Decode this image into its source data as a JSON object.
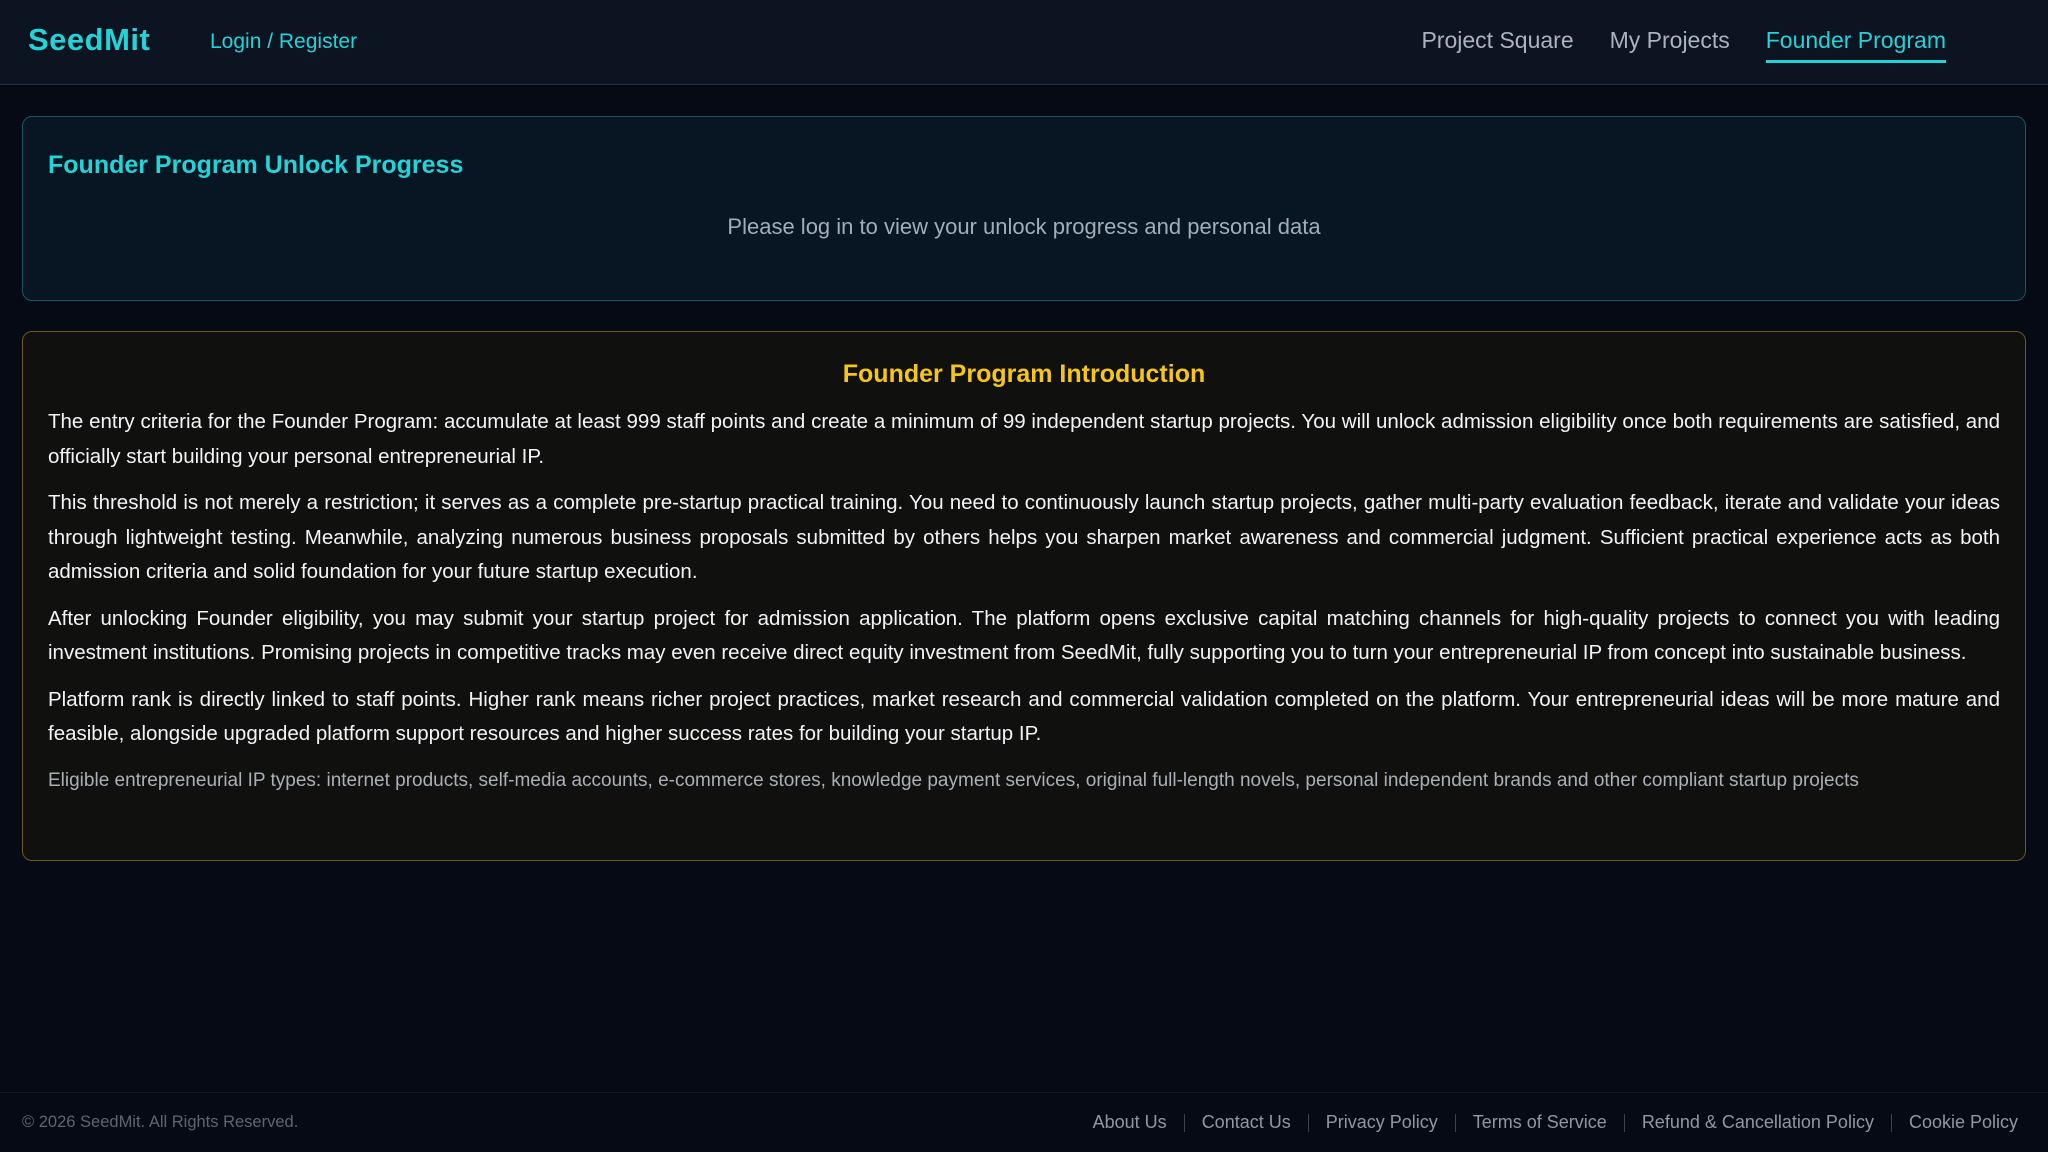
{
  "header": {
    "logo": "SeedMit",
    "auth_link": "Login / Register",
    "nav": [
      {
        "label": "Project Square",
        "active": false
      },
      {
        "label": "My Projects",
        "active": false
      },
      {
        "label": "Founder Program",
        "active": true
      }
    ]
  },
  "progress_card": {
    "title": "Founder Program Unlock Progress",
    "message": "Please log in to view your unlock progress and personal data"
  },
  "intro_card": {
    "title": "Founder Program Introduction",
    "paragraphs": [
      "The entry criteria for the Founder Program: accumulate at least 999 staff points and create a minimum of 99 independent startup projects. You will unlock admission eligibility once both requirements are satisfied, and officially start building your personal entrepreneurial IP.",
      "This threshold is not merely a restriction; it serves as a complete pre-startup practical training. You need to continuously launch startup projects, gather multi-party evaluation feedback, iterate and validate your ideas through lightweight testing. Meanwhile, analyzing numerous business proposals submitted by others helps you sharpen market awareness and commercial judgment. Sufficient practical experience acts as both admission criteria and solid foundation for your future startup execution.",
      "After unlocking Founder eligibility, you may submit your startup project for admission application. The platform opens exclusive capital matching channels for high-quality projects to connect you with leading investment institutions. Promising projects in competitive tracks may even receive direct equity investment from SeedMit, fully supporting you to turn your entrepreneurial IP from concept into sustainable business.",
      "Platform rank is directly linked to staff points. Higher rank means richer project practices, market research and commercial validation completed on the platform. Your entrepreneurial ideas will be more mature and feasible, alongside upgraded platform support resources and higher success rates for building your startup IP."
    ],
    "note": "Eligible entrepreneurial IP types: internet products, self-media accounts, e-commerce stores, knowledge payment services, original full-length novels, personal independent brands and other compliant startup projects"
  },
  "footer": {
    "copyright": "© 2026 SeedMit. All Rights Reserved.",
    "links": [
      "About Us",
      "Contact Us",
      "Privacy Policy",
      "Terms of Service",
      "Refund & Cancellation Policy",
      "Cookie Policy"
    ]
  },
  "colors": {
    "accent": "#22d3d8",
    "gold": "#f5c518",
    "background": "#050a14"
  }
}
